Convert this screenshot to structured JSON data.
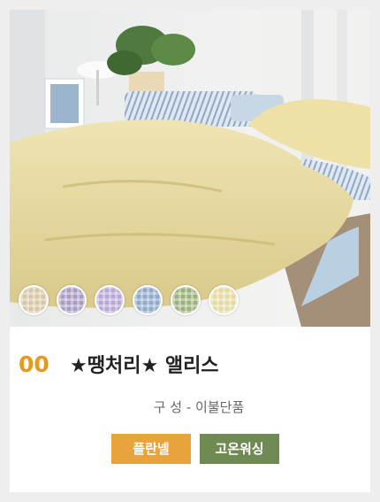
{
  "product": {
    "number": "00",
    "title": "★땡처리★ 앨리스",
    "composition": "구 성 - 이불단품",
    "image_alt": "앨리스 이불 상품 이미지"
  },
  "swatches": [
    {
      "name": "swatch-beige-check",
      "color": "#d8c7a6"
    },
    {
      "name": "swatch-purple-check",
      "color": "#a99cc4"
    },
    {
      "name": "swatch-lavender-check",
      "color": "#b7a7d6"
    },
    {
      "name": "swatch-blue-floral",
      "color": "#8fa9c9"
    },
    {
      "name": "swatch-green",
      "color": "#9bb07a"
    },
    {
      "name": "swatch-yellow",
      "color": "#e5d9a2"
    }
  ],
  "tags": [
    {
      "label": "플란넬",
      "color": "#e9a33c"
    },
    {
      "label": "고온워싱",
      "color": "#6f8a52"
    }
  ],
  "colors": {
    "accent": "#e49a1e",
    "background": "#eeeeee"
  }
}
